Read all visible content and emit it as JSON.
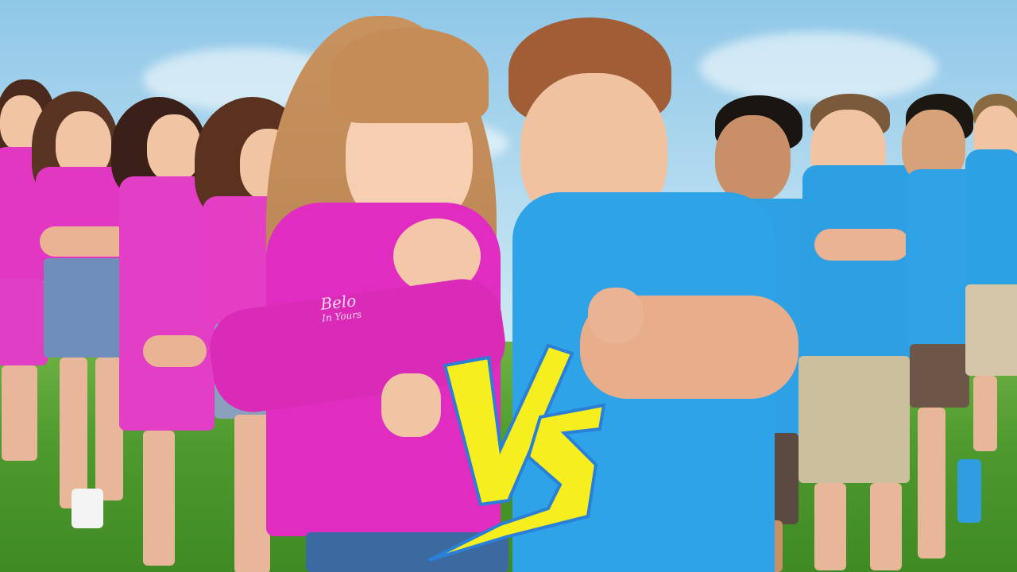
{
  "scene": {
    "description_colors": {
      "sky": "#a9d6ee",
      "grass": "#4e9a2e",
      "team_pink": "#e02fbf",
      "team_blue": "#2aa3e6",
      "vs_yellow": "#f6ee1e",
      "vs_outline": "#2a7fd6"
    }
  },
  "shirt_print": {
    "line1": "Belo",
    "line2": "In Yours"
  },
  "versus": {
    "text": "VS"
  }
}
